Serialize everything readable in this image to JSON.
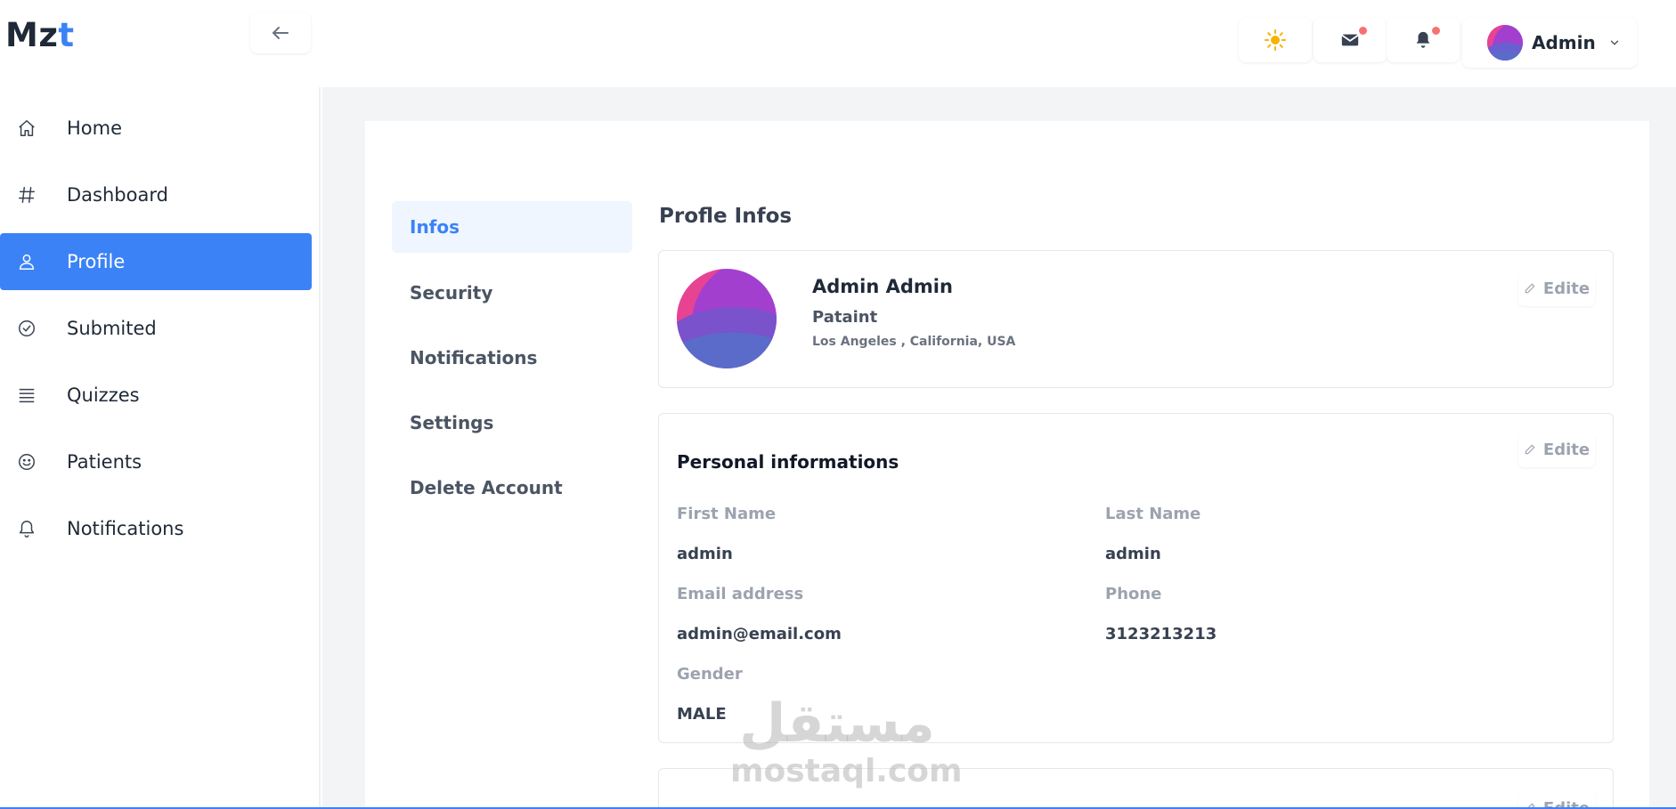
{
  "brand": {
    "logo_main": "Mz",
    "logo_accent": "t"
  },
  "header": {
    "user_name": "Admin",
    "mail_has_notification": true,
    "bell_has_notification": true
  },
  "sidebar": {
    "items": [
      {
        "label": "Home",
        "icon": "home-icon",
        "active": false
      },
      {
        "label": "Dashboard",
        "icon": "hash-icon",
        "active": false
      },
      {
        "label": "Profile",
        "icon": "user-icon",
        "active": true
      },
      {
        "label": "Submited",
        "icon": "check-circle-icon",
        "active": false
      },
      {
        "label": "Quizzes",
        "icon": "list-icon",
        "active": false
      },
      {
        "label": "Patients",
        "icon": "smile-icon",
        "active": false
      },
      {
        "label": "Notifications",
        "icon": "bell-icon",
        "active": false
      }
    ]
  },
  "subnav": {
    "items": [
      {
        "label": "Infos",
        "active": true
      },
      {
        "label": "Security",
        "active": false
      },
      {
        "label": "Notifications",
        "active": false
      },
      {
        "label": "Settings",
        "active": false
      },
      {
        "label": "Delete Account",
        "active": false
      }
    ]
  },
  "profile": {
    "section_title": "Profle Infos",
    "name": "Admin Admin",
    "role": "Pataint",
    "location": "Los Angeles , California, USA",
    "edit_label": "Edite"
  },
  "personal": {
    "title": "Personal informations",
    "edit_label": "Edite",
    "fields": [
      {
        "label": "First Name",
        "value": "admin"
      },
      {
        "label": "Last Name",
        "value": "admin"
      },
      {
        "label": "Email address",
        "value": "admin@email.com"
      },
      {
        "label": "Phone",
        "value": "3123213213"
      },
      {
        "label": "Gender",
        "value": "MALE"
      }
    ]
  },
  "third": {
    "edit_label": "Edite"
  },
  "watermark": {
    "arabic": "مستقل",
    "latin": "mostaql.com"
  },
  "colors": {
    "accent": "#3b82f6",
    "notification_dot": "#f87171",
    "sun": "#f5b400"
  }
}
